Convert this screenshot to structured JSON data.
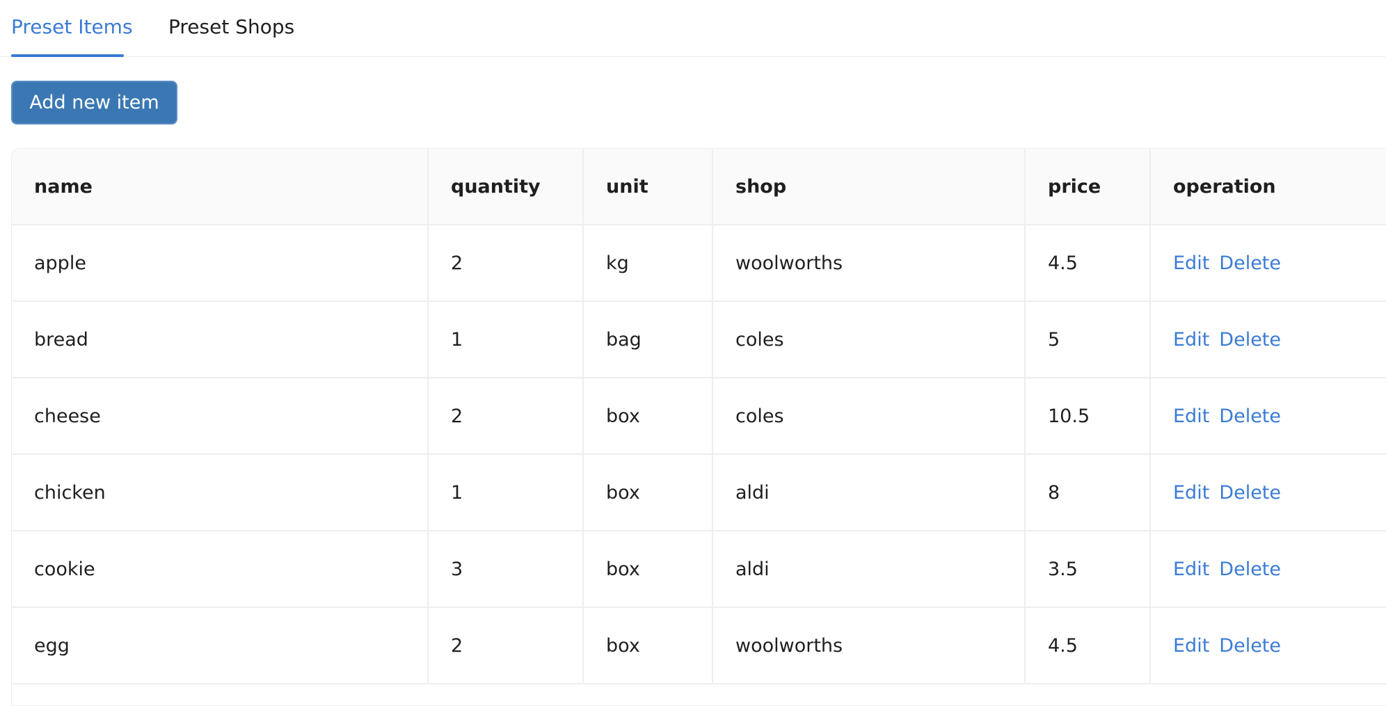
{
  "tabs": [
    {
      "label": "Preset Items",
      "active": true
    },
    {
      "label": "Preset Shops",
      "active": false
    }
  ],
  "toolbar": {
    "add_label": "Add new item"
  },
  "table": {
    "columns": [
      "name",
      "quantity",
      "unit",
      "shop",
      "price",
      "operation"
    ],
    "rows": [
      {
        "name": "apple",
        "quantity": "2",
        "unit": "kg",
        "shop": "woolworths",
        "price": "4.5"
      },
      {
        "name": "bread",
        "quantity": "1",
        "unit": "bag",
        "shop": "coles",
        "price": "5"
      },
      {
        "name": "cheese",
        "quantity": "2",
        "unit": "box",
        "shop": "coles",
        "price": "10.5"
      },
      {
        "name": "chicken",
        "quantity": "1",
        "unit": "box",
        "shop": "aldi",
        "price": "8"
      },
      {
        "name": "cookie",
        "quantity": "3",
        "unit": "box",
        "shop": "aldi",
        "price": "3.5"
      },
      {
        "name": "egg",
        "quantity": "2",
        "unit": "box",
        "shop": "woolworths",
        "price": "4.5"
      }
    ],
    "operations": {
      "edit_label": "Edit",
      "delete_label": "Delete"
    }
  },
  "colors": {
    "accent": "#3a7bd5",
    "button": "#3b78b3",
    "header_bg": "#fafafa",
    "border": "#eeeeee"
  }
}
